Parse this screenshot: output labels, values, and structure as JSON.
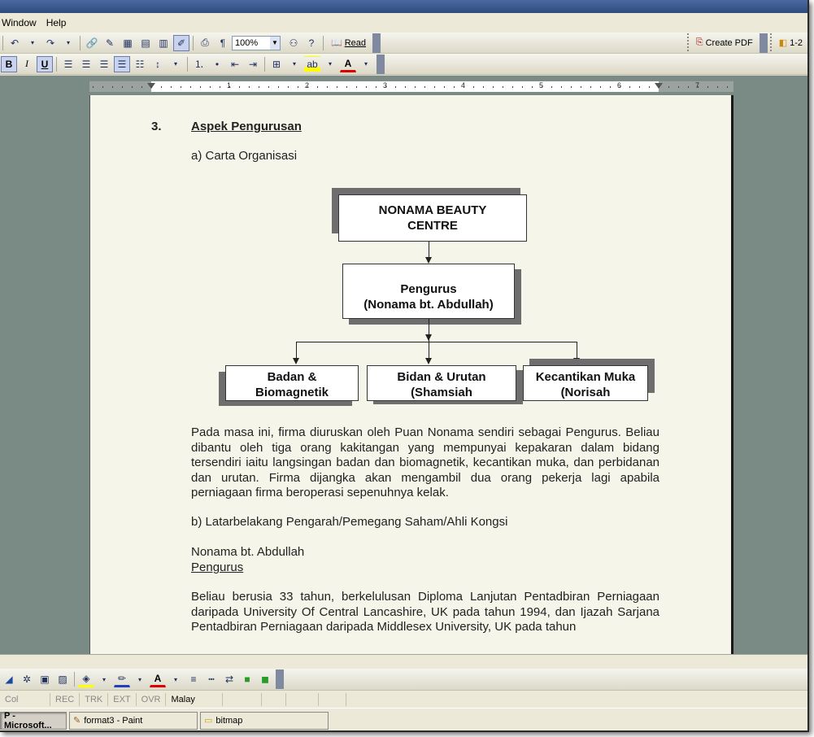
{
  "menubar": {
    "items": [
      "Window",
      "Help"
    ]
  },
  "toolbar": {
    "zoom": "100%",
    "read_label": "Read",
    "create_pdf_label": "Create PDF",
    "right_label": "1-2"
  },
  "format_toolbar": {
    "bold": "B",
    "italic": "I",
    "underline": "U"
  },
  "ruler": {
    "numbers": [
      "1",
      "2",
      "3",
      "4",
      "5",
      "6",
      "7"
    ]
  },
  "document": {
    "section_number": "3.",
    "section_title": "Aspek Pengurusan",
    "subsection_a": "a)  Carta Organisasi",
    "org_chart": {
      "top": [
        "NONAMA BEAUTY",
        "CENTRE"
      ],
      "manager": [
        "Pengurus",
        "(Nonama bt. Abdullah)"
      ],
      "staff1": [
        "Badan &",
        "Biomagnetik"
      ],
      "staff2": [
        "Bidan & Urutan",
        "(Shamsiah"
      ],
      "staff3": [
        "Kecantikan Muka",
        "(Norisah"
      ]
    },
    "paragraph1": "Pada masa ini, firma diuruskan oleh Puan Nonama sendiri sebagai Pengurus. Beliau dibantu oleh tiga orang kakitangan yang mempunyai kepakaran dalam bidang tersendiri iaitu langsingan badan dan biomagnetik, kecantikan muka, dan perbidanan dan urutan. Firma dijangka akan mengambil dua orang pekerja lagi apabila perniagaan firma beroperasi sepenuhnya kelak.",
    "subsection_b": "b)  Latarbelakang Pengarah/Pemegang Saham/Ahli Kongsi",
    "person_name": "Nonama bt. Abdullah",
    "person_role": "Pengurus",
    "paragraph2": "Beliau berusia 33 tahun, berkelulusan Diploma Lanjutan Pentadbiran Perniagaan daripada University Of Central Lancashire, UK pada tahun 1994, dan Ijazah Sarjana Pentadbiran Perniagaan daripada Middlesex University, UK pada tahun"
  },
  "statusbar": {
    "items": [
      "Col",
      "REC",
      "TRK",
      "EXT",
      "OVR",
      "Malay"
    ]
  },
  "taskbar": {
    "items": [
      "P - Microsoft...",
      "format3 - Paint",
      "bitmap"
    ]
  }
}
